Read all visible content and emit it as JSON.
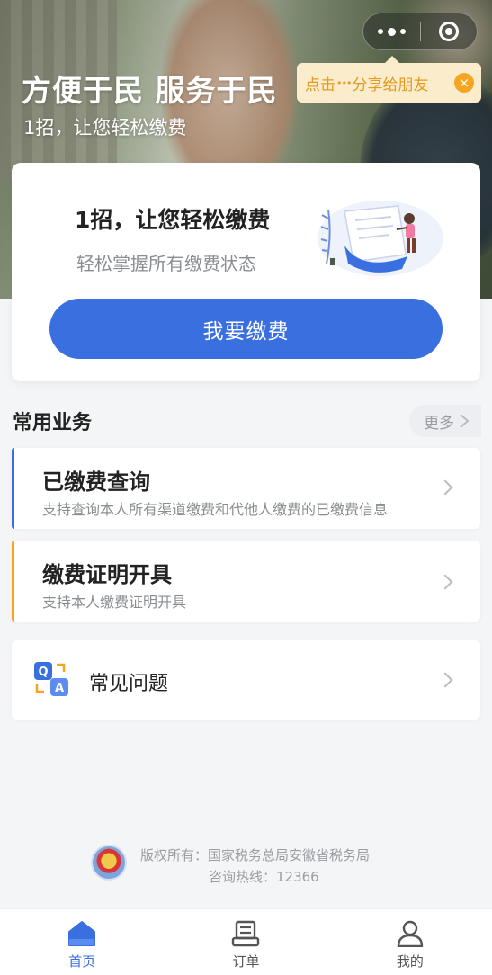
{
  "hero": {
    "title": "方便于民 服务于民",
    "subtitle": "1招，让您轻松缴费"
  },
  "share_tip": {
    "before": "点击",
    "dots": "•••",
    "after": "分享给朋友",
    "close": "×"
  },
  "pay_card": {
    "title": "1招，让您轻松缴费",
    "subtitle": "轻松掌握所有缴费状态",
    "button": "我要缴费"
  },
  "section": {
    "title": "常用业务",
    "more": "更多"
  },
  "services": [
    {
      "title": "已缴费查询",
      "desc": "支持查询本人所有渠道缴费和代他人缴费的已缴费信息",
      "accent": "#3a6fe0"
    },
    {
      "title": "缴费证明开具",
      "desc": "支持本人缴费证明开具",
      "accent": "#f4a623"
    }
  ],
  "faq": {
    "label": "常见问题"
  },
  "footer": {
    "copyright": "版权所有：国家税务总局安徽省税务局",
    "hotline": "咨询热线：12366"
  },
  "tabbar": {
    "tabs": [
      {
        "label": "首页",
        "icon": "home-icon",
        "active": true
      },
      {
        "label": "订单",
        "icon": "order-icon",
        "active": false
      },
      {
        "label": "我的",
        "icon": "user-icon",
        "active": false
      }
    ]
  },
  "colors": {
    "primary": "#3a6fe0",
    "accent_orange": "#f4a623",
    "background": "#f4f5f7"
  }
}
